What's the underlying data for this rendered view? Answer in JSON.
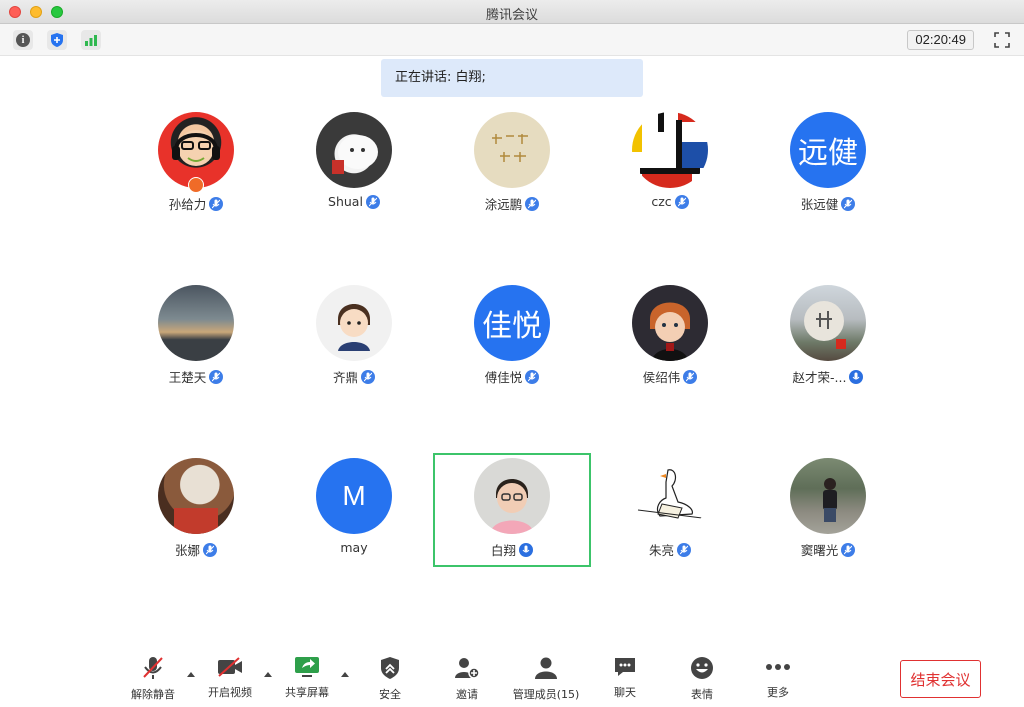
{
  "window": {
    "title": "腾讯会议"
  },
  "toolbar": {
    "info_icon": "info-icon",
    "shield_icon": "security-shield-icon",
    "signal_icon": "signal-icon",
    "timer": "02:20:49",
    "fullscreen_icon": "fullscreen-icon"
  },
  "speaking": {
    "text": "正在讲话: 白翔;"
  },
  "participants": [
    {
      "name": "孙给力",
      "avatar_type": "photo",
      "host": true,
      "mic": "muted"
    },
    {
      "name": "Shual",
      "avatar_type": "photo",
      "mic": "muted"
    },
    {
      "name": "涂远鹏",
      "avatar_type": "photo",
      "mic": "muted"
    },
    {
      "name": "czc",
      "avatar_type": "photo",
      "mic": "muted"
    },
    {
      "name": "张远健",
      "avatar_type": "text",
      "avatar_text": "远健",
      "mic": "muted"
    },
    {
      "name": "王楚天",
      "avatar_type": "photo",
      "mic": "muted"
    },
    {
      "name": "齐鼎",
      "avatar_type": "photo",
      "mic": "muted"
    },
    {
      "name": "傅佳悦",
      "avatar_type": "text",
      "avatar_text": "佳悦",
      "mic": "muted"
    },
    {
      "name": "侯绍伟",
      "avatar_type": "photo",
      "mic": "muted"
    },
    {
      "name": "赵才荣-...",
      "avatar_type": "photo",
      "mic": "on"
    },
    {
      "name": "张娜",
      "avatar_type": "photo",
      "mic": "muted"
    },
    {
      "name": "may",
      "avatar_type": "text",
      "avatar_text": "M",
      "mic": "none"
    },
    {
      "name": "白翔",
      "avatar_type": "photo",
      "mic": "on",
      "active_speaker": true
    },
    {
      "name": "朱亮",
      "avatar_type": "photo",
      "mic": "muted"
    },
    {
      "name": "窦曙光",
      "avatar_type": "photo",
      "mic": "muted"
    }
  ],
  "controls": {
    "unmute": {
      "label": "解除静音",
      "icon": "mic-muted-icon"
    },
    "video": {
      "label": "开启视频",
      "icon": "camera-off-icon"
    },
    "share": {
      "label": "共享屏幕",
      "icon": "share-screen-icon"
    },
    "security": {
      "label": "安全",
      "icon": "security-icon"
    },
    "invite": {
      "label": "邀请",
      "icon": "invite-icon"
    },
    "members": {
      "label": "管理成员(15)",
      "icon": "members-icon"
    },
    "chat": {
      "label": "聊天",
      "icon": "chat-icon"
    },
    "reactions": {
      "label": "表情",
      "icon": "emoji-icon"
    },
    "more": {
      "label": "更多",
      "icon": "more-icon"
    }
  },
  "end_meeting": {
    "label": "结束会议"
  },
  "colors": {
    "accent_blue": "#2673f0",
    "active_green": "#3cc46a",
    "end_red": "#e03131",
    "banner_bg": "#dde9fa"
  }
}
